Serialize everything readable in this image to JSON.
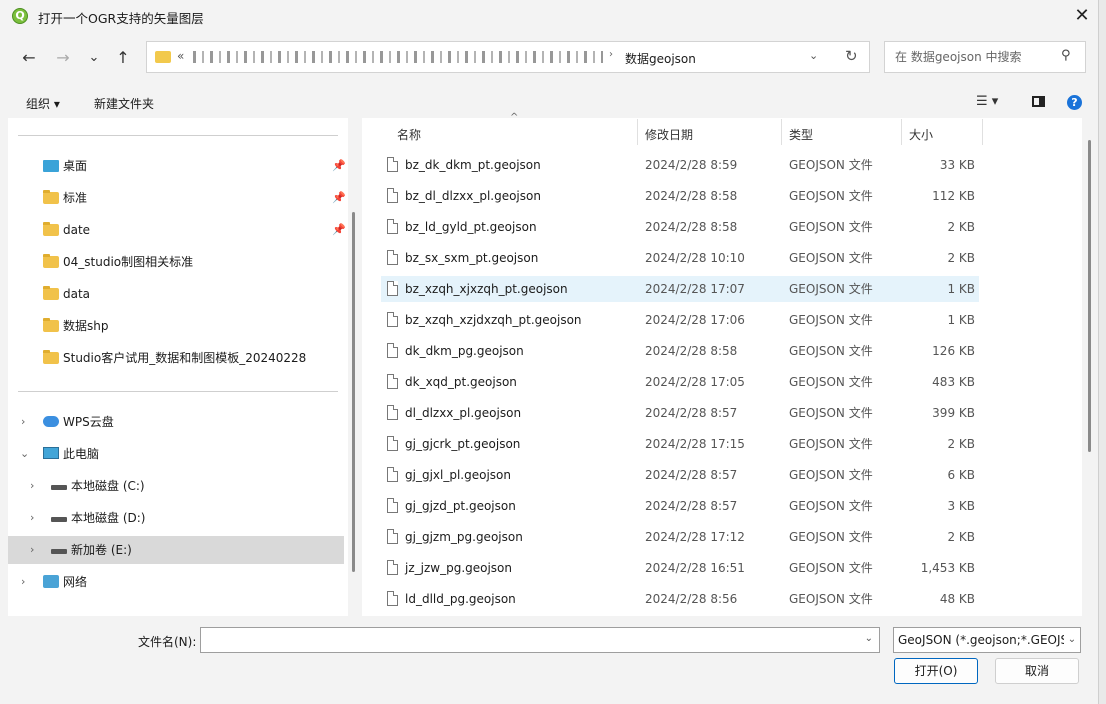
{
  "window": {
    "title": "打开一个OGR支持的矢量图层",
    "app_icon": "qgis-icon",
    "close_label": "✕"
  },
  "nav": {
    "back": "←",
    "forward": "→",
    "recent": "⌄",
    "up": "↑"
  },
  "address": {
    "prefix": "«",
    "separator": "›",
    "current_folder": "数据geojson",
    "dropdown": "⌄",
    "refresh": "↻"
  },
  "search": {
    "placeholder": "在 数据geojson 中搜索",
    "value": ""
  },
  "toolbar": {
    "organize": "组织 ▾",
    "new_folder": "新建文件夹",
    "view_menu": "☰ ▾",
    "help": "?"
  },
  "sidebar": {
    "quick": [
      {
        "label": "桌面",
        "icon": "desktop-icon",
        "pinned": true
      },
      {
        "label": "标准",
        "icon": "folder-icon",
        "pinned": true
      },
      {
        "label": "date",
        "icon": "folder-icon",
        "pinned": true
      },
      {
        "label": "04_studio制图相关标准",
        "icon": "folder-icon",
        "pinned": false
      },
      {
        "label": "data",
        "icon": "folder-icon",
        "pinned": false
      },
      {
        "label": "数据shp",
        "icon": "folder-icon",
        "pinned": false
      },
      {
        "label": "Studio客户试用_数据和制图模板_20240228",
        "icon": "folder-icon",
        "pinned": false
      }
    ],
    "tree": [
      {
        "label": "WPS云盘",
        "icon": "cloud-icon",
        "expander": "›"
      },
      {
        "label": "此电脑",
        "icon": "computer-icon",
        "expander": "⌄"
      },
      {
        "label": "本地磁盘 (C:)",
        "icon": "drive-icon",
        "expander": "›"
      },
      {
        "label": "本地磁盘 (D:)",
        "icon": "drive-icon",
        "expander": "›"
      },
      {
        "label": "新加卷 (E:)",
        "icon": "drive-icon",
        "expander": "›"
      },
      {
        "label": "网络",
        "icon": "network-icon",
        "expander": "›"
      }
    ],
    "pin_glyph": "📌"
  },
  "columns": {
    "name": "名称",
    "modified": "修改日期",
    "type": "类型",
    "size": "大小"
  },
  "files": [
    {
      "name": "bz_dk_dkm_pt.geojson",
      "modified": "2024/2/28 8:59",
      "type": "GEOJSON 文件",
      "size": "33 KB"
    },
    {
      "name": "bz_dl_dlzxx_pl.geojson",
      "modified": "2024/2/28 8:58",
      "type": "GEOJSON 文件",
      "size": "112 KB"
    },
    {
      "name": "bz_ld_gyld_pt.geojson",
      "modified": "2024/2/28 8:58",
      "type": "GEOJSON 文件",
      "size": "2 KB"
    },
    {
      "name": "bz_sx_sxm_pt.geojson",
      "modified": "2024/2/28 10:10",
      "type": "GEOJSON 文件",
      "size": "2 KB"
    },
    {
      "name": "bz_xzqh_xjxzqh_pt.geojson",
      "modified": "2024/2/28 17:07",
      "type": "GEOJSON 文件",
      "size": "1 KB"
    },
    {
      "name": "bz_xzqh_xzjdxzqh_pt.geojson",
      "modified": "2024/2/28 17:06",
      "type": "GEOJSON 文件",
      "size": "1 KB"
    },
    {
      "name": "dk_dkm_pg.geojson",
      "modified": "2024/2/28 8:58",
      "type": "GEOJSON 文件",
      "size": "126 KB"
    },
    {
      "name": "dk_xqd_pt.geojson",
      "modified": "2024/2/28 17:05",
      "type": "GEOJSON 文件",
      "size": "483 KB"
    },
    {
      "name": "dl_dlzxx_pl.geojson",
      "modified": "2024/2/28 8:57",
      "type": "GEOJSON 文件",
      "size": "399 KB"
    },
    {
      "name": "gj_gjcrk_pt.geojson",
      "modified": "2024/2/28 17:15",
      "type": "GEOJSON 文件",
      "size": "2 KB"
    },
    {
      "name": "gj_gjxl_pl.geojson",
      "modified": "2024/2/28 8:57",
      "type": "GEOJSON 文件",
      "size": "6 KB"
    },
    {
      "name": "gj_gjzd_pt.geojson",
      "modified": "2024/2/28 8:57",
      "type": "GEOJSON 文件",
      "size": "3 KB"
    },
    {
      "name": "gj_gjzm_pg.geojson",
      "modified": "2024/2/28 17:12",
      "type": "GEOJSON 文件",
      "size": "2 KB"
    },
    {
      "name": "jz_jzw_pg.geojson",
      "modified": "2024/2/28 16:51",
      "type": "GEOJSON 文件",
      "size": "1,453 KB"
    },
    {
      "name": "ld_dlld_pg.geojson",
      "modified": "2024/2/28 8:56",
      "type": "GEOJSON 文件",
      "size": "48 KB"
    }
  ],
  "footer": {
    "filename_label": "文件名(N):",
    "filename_value": "",
    "filter": "GeoJSON (*.geojson;*.GEOJSON)",
    "open_button": "打开(O)",
    "cancel_button": "取消"
  },
  "colors": {
    "accent": "#0067c0",
    "hover_row": "#e5f3fb",
    "selected_nav": "#d9d9d9"
  }
}
